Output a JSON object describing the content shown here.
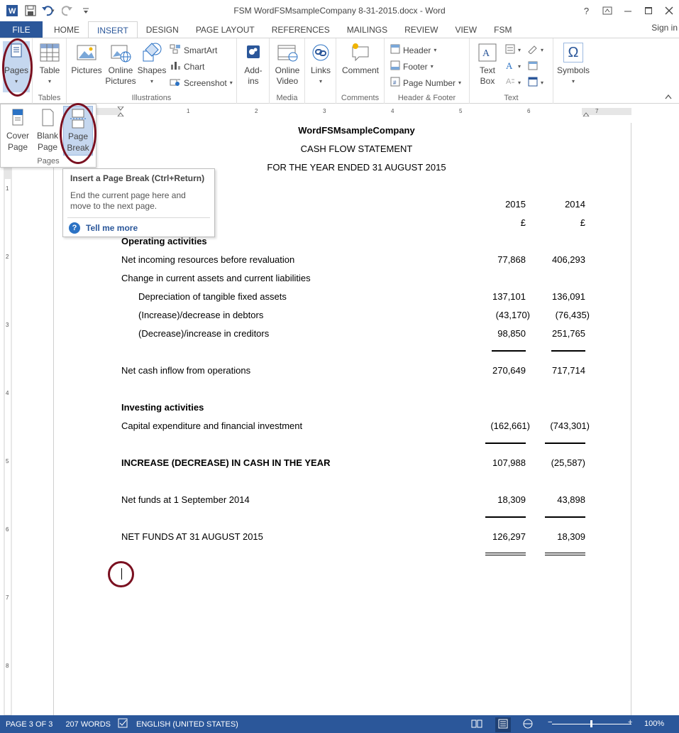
{
  "window": {
    "title": "FSM WordFSMsampleCompany 8-31-2015.docx - Word",
    "help": "?",
    "signin": "Sign in"
  },
  "tabs": [
    "FILE",
    "HOME",
    "INSERT",
    "DESIGN",
    "PAGE LAYOUT",
    "REFERENCES",
    "MAILINGS",
    "REVIEW",
    "VIEW",
    "FSM"
  ],
  "ribbon": {
    "pages": {
      "label": "Pages",
      "group": ""
    },
    "tables": {
      "table": "Table",
      "group": "Tables"
    },
    "illustrations": {
      "pictures": "Pictures",
      "online_pictures_1": "Online",
      "online_pictures_2": "Pictures",
      "shapes": "Shapes",
      "smartart": "SmartArt",
      "chart": "Chart",
      "screenshot": "Screenshot",
      "group": "Illustrations"
    },
    "addins": {
      "label_1": "Add-",
      "label_2": "ins"
    },
    "media": {
      "label_1": "Online",
      "label_2": "Video",
      "group": "Media"
    },
    "links": {
      "label": "Links"
    },
    "comments": {
      "label": "Comment",
      "group": "Comments"
    },
    "header_footer": {
      "header": "Header",
      "footer": "Footer",
      "page_number": "Page Number",
      "group": "Header & Footer"
    },
    "text": {
      "textbox_1": "Text",
      "textbox_2": "Box",
      "group": "Text"
    },
    "symbols": {
      "label": "Symbols",
      "omega": "Ω"
    }
  },
  "pages_dropdown": {
    "cover_1": "Cover",
    "cover_2": "Page",
    "blank_1": "Blank",
    "blank_2": "Page",
    "break_1": "Page",
    "break_2": "Break",
    "group": "Pages"
  },
  "tooltip": {
    "title": "Insert a Page Break (Ctrl+Return)",
    "body": "End the current page here and move to the next page.",
    "help": "Tell me more",
    "help_icon": "?"
  },
  "ruler": {
    "h_marks": [
      "1",
      "2",
      "3",
      "4",
      "5",
      "6",
      "7"
    ],
    "v_marks": [
      "1",
      "2",
      "3",
      "4",
      "5",
      "6",
      "7",
      "8"
    ]
  },
  "document": {
    "company": "WordFSMsampleCompany",
    "statement": "CASH FLOW STATEMENT",
    "period": "FOR THE YEAR ENDED 31 AUGUST 2015",
    "col_2015": "2015",
    "col_2014": "2014",
    "currency_2015": "£",
    "currency_2014": "£",
    "operating": "Operating activities",
    "lines": [
      {
        "label": "Net incoming resources before revaluation",
        "v2015": "77,868",
        "v2014": "406,293"
      },
      {
        "label": "Change in current assets and current liabilities",
        "v2015": "",
        "v2014": ""
      },
      {
        "label": "Depreciation of tangible fixed assets",
        "v2015": "137,101",
        "v2014": "136,091"
      },
      {
        "label": "(Increase)/decrease in debtors",
        "v2015": "(43,170)",
        "v2014": "(76,435)"
      },
      {
        "label": "(Decrease)/increase in creditors",
        "v2015": "98,850",
        "v2014": "251,765"
      }
    ],
    "net_cash_inflow": {
      "label": "Net cash inflow from operations",
      "v2015": "270,649",
      "v2014": "717,714"
    },
    "investing": "Investing activities",
    "capex": {
      "label": "Capital expenditure and financial investment",
      "v2015": "(162,661)",
      "v2014": "(743,301)"
    },
    "increase": {
      "label": "INCREASE (DECREASE) IN CASH IN THE YEAR",
      "v2015": "107,988",
      "v2014": "(25,587)"
    },
    "net_funds_start": {
      "label": "Net funds at 1 September 2014",
      "v2015": "18,309",
      "v2014": "43,898"
    },
    "net_funds_end": {
      "label": "NET FUNDS AT 31 AUGUST 2015",
      "v2015": "126,297",
      "v2014": "18,309"
    }
  },
  "statusbar": {
    "page": "PAGE 3 OF 3",
    "words": "207 WORDS",
    "language": "ENGLISH (UNITED STATES)",
    "zoom": "100%",
    "zoom_minus": "−",
    "zoom_plus": "+"
  },
  "colors": {
    "accent": "#2b579a",
    "annotation": "#7a1020"
  }
}
